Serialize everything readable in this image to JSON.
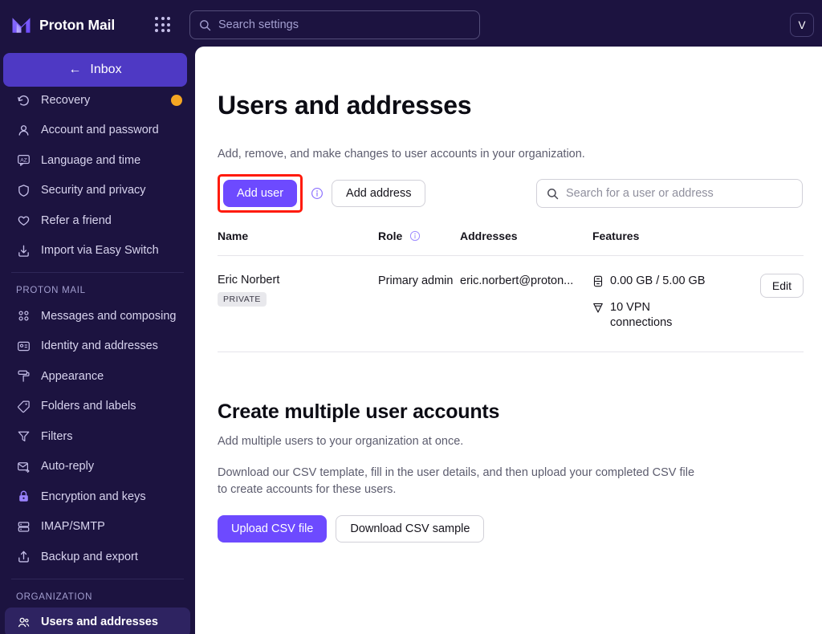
{
  "topbar": {
    "brand": "Proton Mail",
    "apps_icon": "apps-grid-icon",
    "search": {
      "icon": "search-icon",
      "placeholder": "Search settings",
      "value": ""
    },
    "avatar_initial": "V"
  },
  "sidebar": {
    "inbox_button": {
      "label": "Inbox",
      "back_arrow": "←"
    },
    "items_top": [
      {
        "label": "Recovery",
        "icon": "recovery-icon",
        "badge": true,
        "clipped": true
      },
      {
        "label": "Account and password",
        "icon": "user-icon",
        "badge": false
      },
      {
        "label": "Language and time",
        "icon": "language-icon",
        "badge": false
      },
      {
        "label": "Security and privacy",
        "icon": "shield-icon",
        "badge": false
      },
      {
        "label": "Refer a friend",
        "icon": "heart-icon",
        "badge": false
      },
      {
        "label": "Import via Easy Switch",
        "icon": "import-icon",
        "badge": false
      }
    ],
    "group_mail_title": "PROTON MAIL",
    "items_mail": [
      {
        "label": "Messages and composing",
        "icon": "grid-dots-icon"
      },
      {
        "label": "Identity and addresses",
        "icon": "id-card-icon"
      },
      {
        "label": "Appearance",
        "icon": "paint-roller-icon"
      },
      {
        "label": "Folders and labels",
        "icon": "tag-icon"
      },
      {
        "label": "Filters",
        "icon": "filter-icon"
      },
      {
        "label": "Auto-reply",
        "icon": "envelope-reply-icon"
      },
      {
        "label": "Encryption and keys",
        "icon": "lock-icon"
      },
      {
        "label": "IMAP/SMTP",
        "icon": "server-icon"
      },
      {
        "label": "Backup and export",
        "icon": "upload-box-icon"
      }
    ],
    "group_org_title": "ORGANIZATION",
    "items_org": [
      {
        "label": "Users and addresses",
        "icon": "users-icon",
        "active": true
      }
    ]
  },
  "main": {
    "page_title": "Users and addresses",
    "description": "Add, remove, and make changes to user accounts in your organization.",
    "toolbar": {
      "add_user_label": "Add user",
      "add_user_highlighted": true,
      "highlight_color": "#FF1A0A",
      "info_icon": "info-icon",
      "add_address_label": "Add address",
      "search": {
        "icon": "search-icon",
        "placeholder": "Search for a user or address",
        "value": ""
      }
    },
    "table": {
      "headers": {
        "name": "Name",
        "role": "Role",
        "role_info_icon": "info-icon",
        "addresses": "Addresses",
        "features": "Features",
        "actions": ""
      },
      "rows": [
        {
          "name": "Eric Norbert",
          "badge": "PRIVATE",
          "role": "Primary admin",
          "address": "eric.norbert@proton...",
          "features": [
            {
              "icon": "storage-icon",
              "text": "0.00 GB / 5.00 GB"
            },
            {
              "icon": "vpn-icon",
              "text": "10 VPN connections"
            }
          ],
          "action_label": "Edit"
        }
      ]
    },
    "bulk": {
      "title": "Create multiple user accounts",
      "paragraph1": "Add multiple users to your organization at once.",
      "paragraph2": "Download our CSV template, fill in the user details, and then upload your completed CSV file to create accounts for these users.",
      "upload_label": "Upload CSV file",
      "download_label": "Download CSV sample"
    }
  },
  "colors": {
    "brand_purple": "#6D4AFF",
    "sidebar_bg": "#1C1340",
    "inbox_btn": "#4E39C4",
    "annotation_red": "#FF1A0A",
    "badge_orange": "#F5A623"
  }
}
